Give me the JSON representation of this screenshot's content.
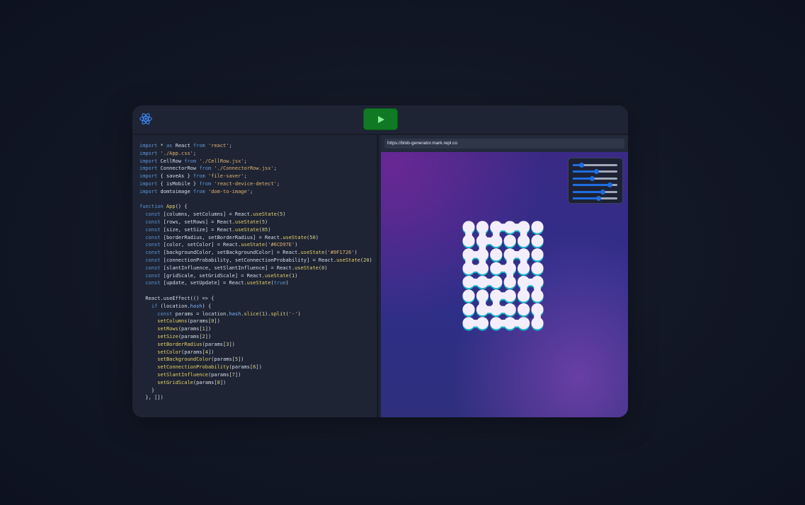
{
  "editor": {
    "lines": [
      [
        [
          "kw",
          "import"
        ],
        [
          "t",
          " * "
        ],
        [
          "kw",
          "as"
        ],
        [
          "t",
          " React "
        ],
        [
          "kw",
          "from"
        ],
        [
          "t",
          " "
        ],
        [
          "str",
          "'react'"
        ],
        [
          "t",
          ";"
        ]
      ],
      [
        [
          "kw",
          "import"
        ],
        [
          "t",
          " "
        ],
        [
          "str",
          "'./App.css'"
        ],
        [
          "t",
          ";"
        ]
      ],
      [
        [
          "kw",
          "import"
        ],
        [
          "t",
          " CellRow "
        ],
        [
          "kw",
          "from"
        ],
        [
          "t",
          " "
        ],
        [
          "str",
          "'./CellRow.jsx'"
        ],
        [
          "t",
          ";"
        ]
      ],
      [
        [
          "kw",
          "import"
        ],
        [
          "t",
          " ConnectorRow "
        ],
        [
          "kw",
          "from"
        ],
        [
          "t",
          " "
        ],
        [
          "str",
          "'./ConnectorRow.jsx'"
        ],
        [
          "t",
          ";"
        ]
      ],
      [
        [
          "kw",
          "import"
        ],
        [
          "t",
          " { saveAs } "
        ],
        [
          "kw",
          "from"
        ],
        [
          "t",
          " "
        ],
        [
          "str",
          "'file-saver'"
        ],
        [
          "t",
          ";"
        ]
      ],
      [
        [
          "kw",
          "import"
        ],
        [
          "t",
          " { isMobile } "
        ],
        [
          "kw",
          "from"
        ],
        [
          "t",
          " "
        ],
        [
          "str",
          "'react-device-detect'"
        ],
        [
          "t",
          ";"
        ]
      ],
      [
        [
          "kw",
          "import"
        ],
        [
          "t",
          " domtoimage "
        ],
        [
          "kw",
          "from"
        ],
        [
          "t",
          " "
        ],
        [
          "str",
          "'dom-to-image'"
        ],
        [
          "t",
          ";"
        ]
      ],
      [
        [
          "t",
          ""
        ]
      ],
      [
        [
          "kw",
          "function"
        ],
        [
          "t",
          " "
        ],
        [
          "fn",
          "App"
        ],
        [
          "t",
          "() {"
        ]
      ],
      [
        [
          "t",
          "  "
        ],
        [
          "kw",
          "const"
        ],
        [
          "t",
          " [columns, setColumns] = React."
        ],
        [
          "fn",
          "useState"
        ],
        [
          "t",
          "("
        ],
        [
          "num",
          "5"
        ],
        [
          "t",
          ")"
        ]
      ],
      [
        [
          "t",
          "  "
        ],
        [
          "kw",
          "const"
        ],
        [
          "t",
          " [rows, setRows] = React."
        ],
        [
          "fn",
          "useState"
        ],
        [
          "t",
          "("
        ],
        [
          "num",
          "5"
        ],
        [
          "t",
          ")"
        ]
      ],
      [
        [
          "t",
          "  "
        ],
        [
          "kw",
          "const"
        ],
        [
          "t",
          " [size, setSize] = React."
        ],
        [
          "fn",
          "useState"
        ],
        [
          "t",
          "("
        ],
        [
          "num",
          "85"
        ],
        [
          "t",
          ")"
        ]
      ],
      [
        [
          "t",
          "  "
        ],
        [
          "kw",
          "const"
        ],
        [
          "t",
          " [borderRadius, setBorderRadius] = React."
        ],
        [
          "fn",
          "useState"
        ],
        [
          "t",
          "("
        ],
        [
          "num",
          "50"
        ],
        [
          "t",
          ")"
        ]
      ],
      [
        [
          "t",
          "  "
        ],
        [
          "kw",
          "const"
        ],
        [
          "t",
          " [color, setColor] = React."
        ],
        [
          "fn",
          "useState"
        ],
        [
          "t",
          "("
        ],
        [
          "str",
          "'#6CD97E'"
        ],
        [
          "t",
          ")"
        ]
      ],
      [
        [
          "t",
          "  "
        ],
        [
          "kw",
          "const"
        ],
        [
          "t",
          " [backgroundColor, setBackgroundColor] = React."
        ],
        [
          "fn",
          "useState"
        ],
        [
          "t",
          "("
        ],
        [
          "str",
          "'#0F1726'"
        ],
        [
          "t",
          ")"
        ]
      ],
      [
        [
          "t",
          "  "
        ],
        [
          "kw",
          "const"
        ],
        [
          "t",
          " [connectionProbability, setConnectionProbability] = React."
        ],
        [
          "fn",
          "useState"
        ],
        [
          "t",
          "("
        ],
        [
          "num",
          "20"
        ],
        [
          "t",
          ")"
        ]
      ],
      [
        [
          "t",
          "  "
        ],
        [
          "kw",
          "const"
        ],
        [
          "t",
          " [slantInfluence, setSlantInfluence] = React."
        ],
        [
          "fn",
          "useState"
        ],
        [
          "t",
          "("
        ],
        [
          "num",
          "0"
        ],
        [
          "t",
          ")"
        ]
      ],
      [
        [
          "t",
          "  "
        ],
        [
          "kw",
          "const"
        ],
        [
          "t",
          " [gridScale, setGridScale] = React."
        ],
        [
          "fn",
          "useState"
        ],
        [
          "t",
          "("
        ],
        [
          "num",
          "1"
        ],
        [
          "t",
          ")"
        ]
      ],
      [
        [
          "t",
          "  "
        ],
        [
          "kw",
          "const"
        ],
        [
          "t",
          " [update, setUpdate] = React."
        ],
        [
          "fn",
          "useState"
        ],
        [
          "t",
          "("
        ],
        [
          "kw",
          "true"
        ],
        [
          "t",
          ")"
        ]
      ],
      [
        [
          "t",
          ""
        ]
      ],
      [
        [
          "t",
          "  React.useEffect(() => {"
        ]
      ],
      [
        [
          "t",
          "    "
        ],
        [
          "kw",
          "if"
        ],
        [
          "t",
          " (location."
        ],
        [
          "prop",
          "hash"
        ],
        [
          "t",
          ") {"
        ]
      ],
      [
        [
          "t",
          "      "
        ],
        [
          "kw",
          "const"
        ],
        [
          "t",
          " params = location."
        ],
        [
          "prop",
          "hash"
        ],
        [
          "t",
          "."
        ],
        [
          "fn",
          "slice"
        ],
        [
          "t",
          "("
        ],
        [
          "num",
          "1"
        ],
        [
          "t",
          ")."
        ],
        [
          "fn",
          "split"
        ],
        [
          "t",
          "("
        ],
        [
          "str",
          "'-'"
        ],
        [
          "t",
          ")"
        ]
      ],
      [
        [
          "t",
          "      "
        ],
        [
          "fn",
          "setColumns"
        ],
        [
          "t",
          "(params["
        ],
        [
          "num",
          "0"
        ],
        [
          "t",
          "])"
        ]
      ],
      [
        [
          "t",
          "      "
        ],
        [
          "fn",
          "setRows"
        ],
        [
          "t",
          "(params["
        ],
        [
          "num",
          "1"
        ],
        [
          "t",
          "])"
        ]
      ],
      [
        [
          "t",
          "      "
        ],
        [
          "fn",
          "setSize"
        ],
        [
          "t",
          "(params["
        ],
        [
          "num",
          "2"
        ],
        [
          "t",
          "])"
        ]
      ],
      [
        [
          "t",
          "      "
        ],
        [
          "fn",
          "setBorderRadius"
        ],
        [
          "t",
          "(params["
        ],
        [
          "num",
          "3"
        ],
        [
          "t",
          "])"
        ]
      ],
      [
        [
          "t",
          "      "
        ],
        [
          "fn",
          "setColor"
        ],
        [
          "t",
          "(params["
        ],
        [
          "num",
          "4"
        ],
        [
          "t",
          "])"
        ]
      ],
      [
        [
          "t",
          "      "
        ],
        [
          "fn",
          "setBackgroundColor"
        ],
        [
          "t",
          "(params["
        ],
        [
          "num",
          "5"
        ],
        [
          "t",
          "])"
        ]
      ],
      [
        [
          "t",
          "      "
        ],
        [
          "fn",
          "setConnectionProbability"
        ],
        [
          "t",
          "(params["
        ],
        [
          "num",
          "6"
        ],
        [
          "t",
          "])"
        ]
      ],
      [
        [
          "t",
          "      "
        ],
        [
          "fn",
          "setSlantInfluence"
        ],
        [
          "t",
          "(params["
        ],
        [
          "num",
          "7"
        ],
        [
          "t",
          "])"
        ]
      ],
      [
        [
          "t",
          "      "
        ],
        [
          "fn",
          "setGridScale"
        ],
        [
          "t",
          "(params["
        ],
        [
          "num",
          "8"
        ],
        [
          "t",
          "])"
        ]
      ],
      [
        [
          "t",
          "    }"
        ]
      ],
      [
        [
          "t",
          "  }, [])"
        ]
      ]
    ]
  },
  "preview": {
    "url": "https://blob-generator.mark.repl.co",
    "sliders": [
      0.2,
      0.53,
      0.43,
      0.83,
      0.68,
      0.58
    ]
  },
  "icons": {
    "logo": "react-logo-icon",
    "run": "play-icon"
  },
  "colors": {
    "run_button": "#0f7a23",
    "slider": "#1f6ee0",
    "blob_face": "#f4eefc",
    "blob_shadow": "#1bb3c9"
  }
}
